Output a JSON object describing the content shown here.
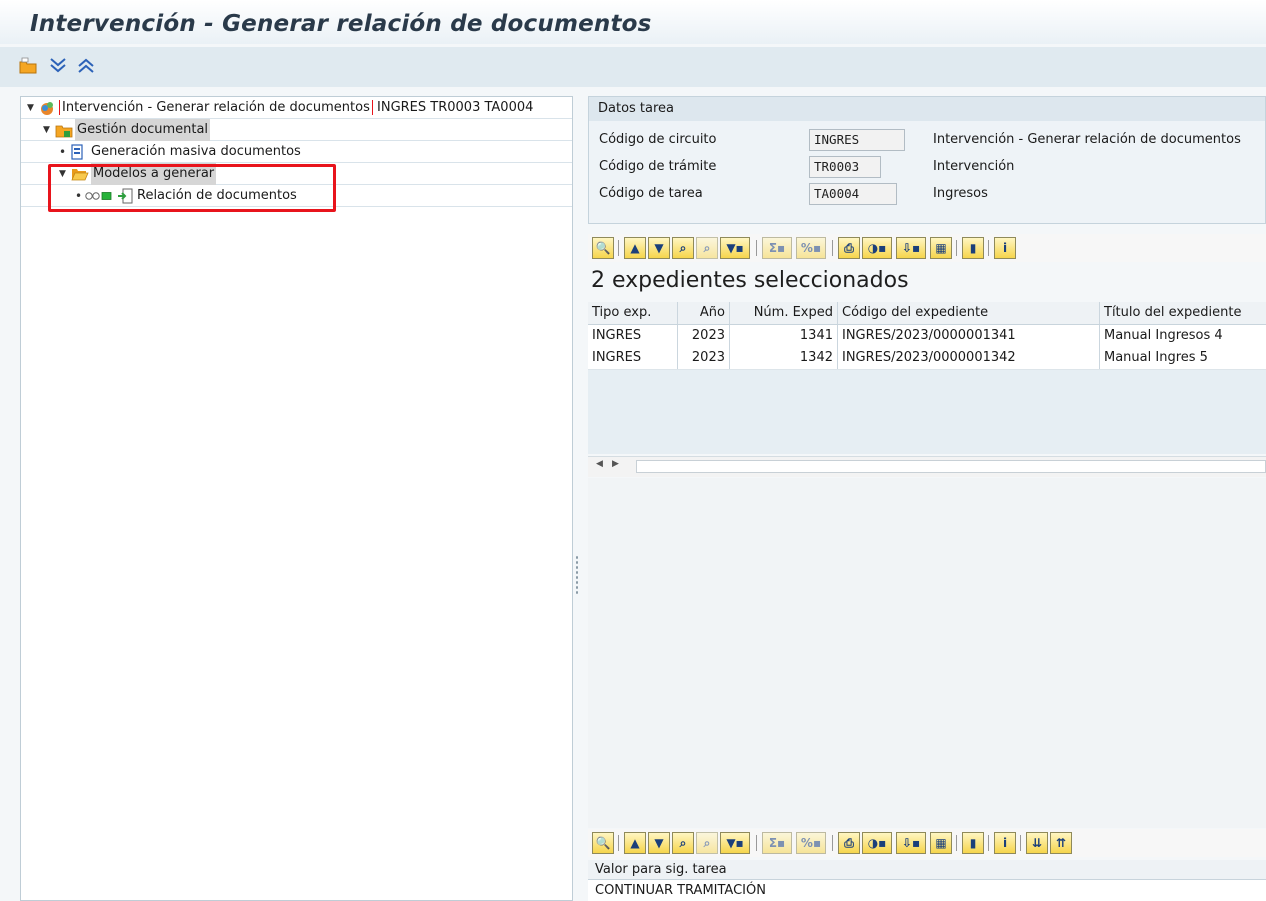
{
  "window": {
    "title": "Intervención - Generar relación de documentos"
  },
  "toolbar": {
    "icons": [
      "new-folder-icon",
      "expand-all-icon",
      "collapse-all-icon"
    ]
  },
  "tree": {
    "root": {
      "label": "Intervención - Generar relación de documentos",
      "suffix": "INGRES TR0003 TA0004"
    },
    "gestion": {
      "label": "Gestión documental"
    },
    "generacion": {
      "label": "Generación masiva documentos"
    },
    "modelos": {
      "label": "Modelos a generar"
    },
    "relacion": {
      "label": "Relación de documentos"
    }
  },
  "datos_tarea": {
    "header": "Datos tarea",
    "fields": [
      {
        "label": "Código de circuito",
        "value": "INGRES",
        "description": "Intervención - Generar relación de documentos"
      },
      {
        "label": "Código de trámite",
        "value": "TR0003",
        "description": "Intervención"
      },
      {
        "label": "Código de tarea",
        "value": "TA0004",
        "description": "Ingresos"
      }
    ]
  },
  "grid": {
    "title": "2 expedientes seleccionados",
    "columns": [
      "Tipo exp.",
      "Año",
      "Núm. Exped",
      "Código del expediente",
      "Título del expediente"
    ],
    "rows": [
      [
        "INGRES",
        "2023",
        "1341",
        "INGRES/2023/0000001341",
        "Manual Ingresos 4"
      ],
      [
        "INGRES",
        "2023",
        "1342",
        "INGRES/2023/0000001342",
        "Manual Ingres 5"
      ]
    ]
  },
  "bottom_grid": {
    "header": "Valor para sig. tarea",
    "value": "CONTINUAR TRAMITACIÓN"
  },
  "colors": {
    "highlight_box": "#e8141c",
    "alv_button": "#f6d54c",
    "folder": "#f5a623"
  }
}
